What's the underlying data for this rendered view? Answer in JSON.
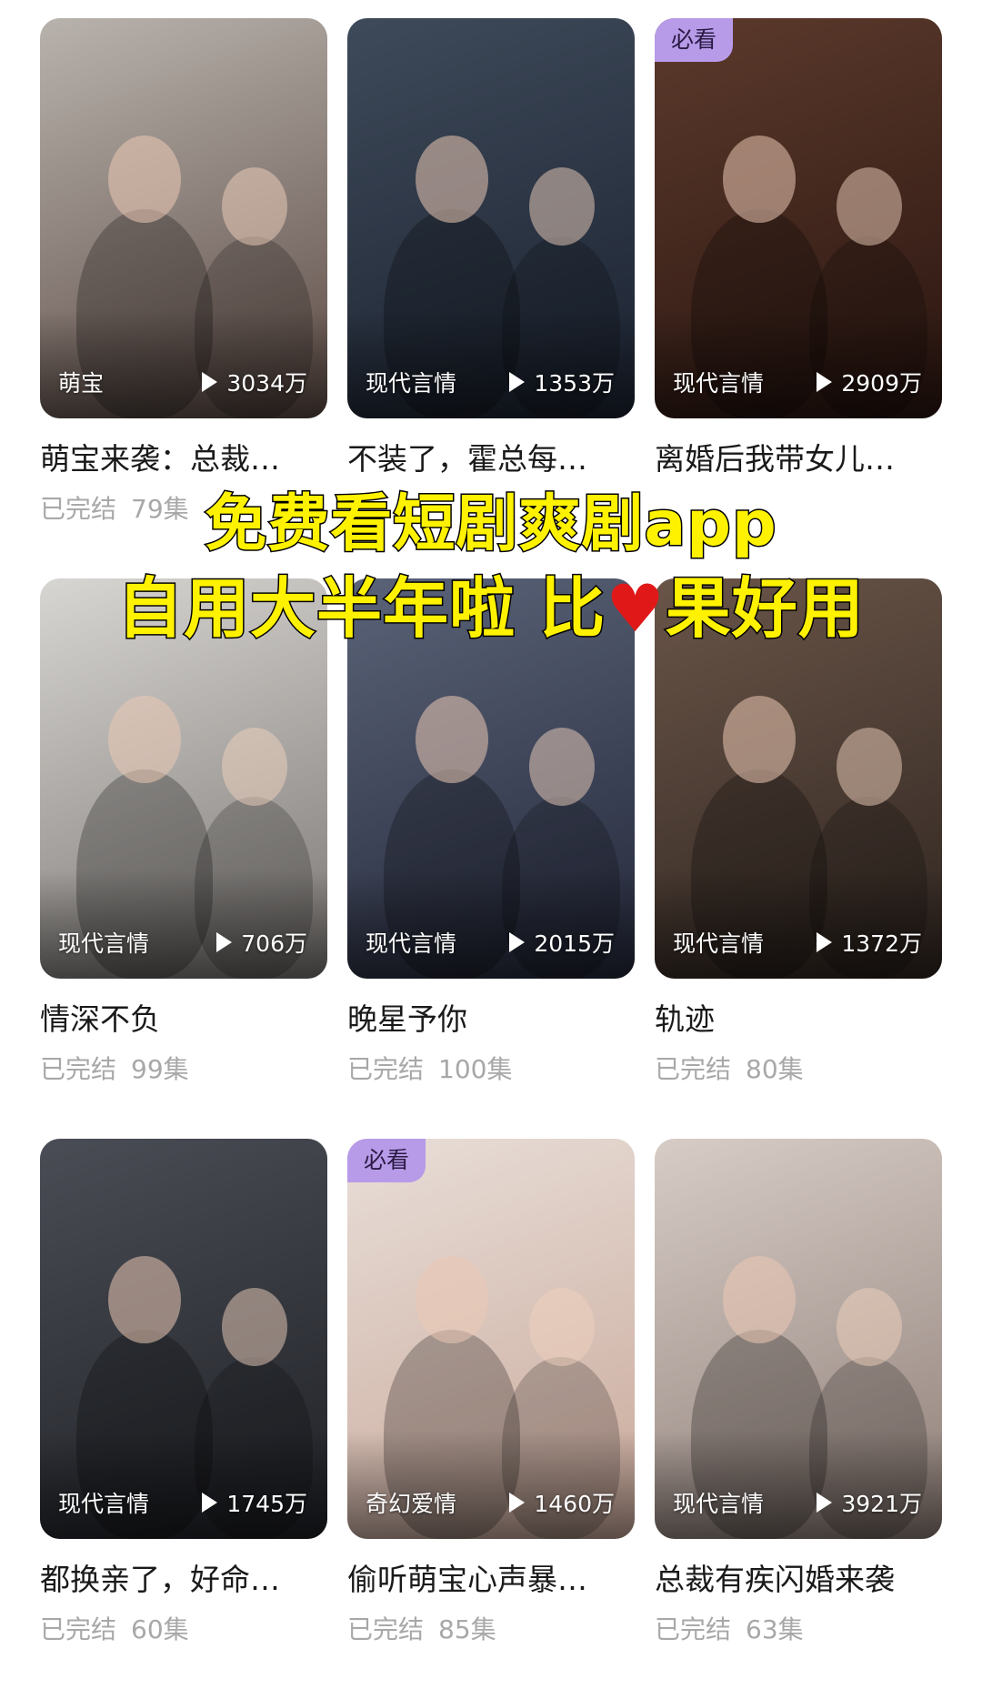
{
  "overlay": {
    "line1": "免费看短剧爽剧app",
    "line2_before": "自用大半年啦 比",
    "line2_heart": "♥",
    "line2_after": "果好用"
  },
  "colors": {
    "badge_bg": "#b79be8",
    "overlay_text": "#fff200",
    "meta_text": "#a8a8a8"
  },
  "cards": [
    {
      "badge": "",
      "genre": "萌宝",
      "plays": "3034万",
      "title": "萌宝来袭：总裁…",
      "status": "已完结",
      "episodes": "79集",
      "poster_colors": [
        "#b9b3ad",
        "#5d4b45"
      ]
    },
    {
      "badge": "",
      "genre": "现代言情",
      "plays": "1353万",
      "title": "不装了，霍总每…",
      "status": "",
      "episodes": "",
      "poster_colors": [
        "#3e4a5a",
        "#1b2230"
      ]
    },
    {
      "badge": "必看",
      "genre": "现代言情",
      "plays": "2909万",
      "title": "离婚后我带女儿…",
      "status": "",
      "episodes": "",
      "poster_colors": [
        "#5c3a2c",
        "#2a1510"
      ]
    },
    {
      "badge": "",
      "genre": "现代言情",
      "plays": "706万",
      "title": "情深不负",
      "status": "已完结",
      "episodes": "99集",
      "poster_colors": [
        "#d8d6d2",
        "#7b7774"
      ]
    },
    {
      "badge": "",
      "genre": "现代言情",
      "plays": "2015万",
      "title": "晚星予你",
      "status": "已完结",
      "episodes": "100集",
      "poster_colors": [
        "#5a6378",
        "#24283a"
      ]
    },
    {
      "badge": "",
      "genre": "现代言情",
      "plays": "1372万",
      "title": "轨迹",
      "status": "已完结",
      "episodes": "80集",
      "poster_colors": [
        "#6a5548",
        "#2f2520"
      ]
    },
    {
      "badge": "",
      "genre": "现代言情",
      "plays": "1745万",
      "title": "都换亲了，好命…",
      "status": "已完结",
      "episodes": "60集",
      "poster_colors": [
        "#4a4d55",
        "#1f2126"
      ]
    },
    {
      "badge": "必看",
      "genre": "奇幻爱情",
      "plays": "1460万",
      "title": "偷听萌宝心声暴…",
      "status": "已完结",
      "episodes": "85集",
      "poster_colors": [
        "#e8ded8",
        "#c9a89a"
      ]
    },
    {
      "badge": "",
      "genre": "现代言情",
      "plays": "3921万",
      "title": "总裁有疾闪婚来袭",
      "status": "已完结",
      "episodes": "63集",
      "poster_colors": [
        "#d7ccc6",
        "#8f7f78"
      ]
    }
  ]
}
